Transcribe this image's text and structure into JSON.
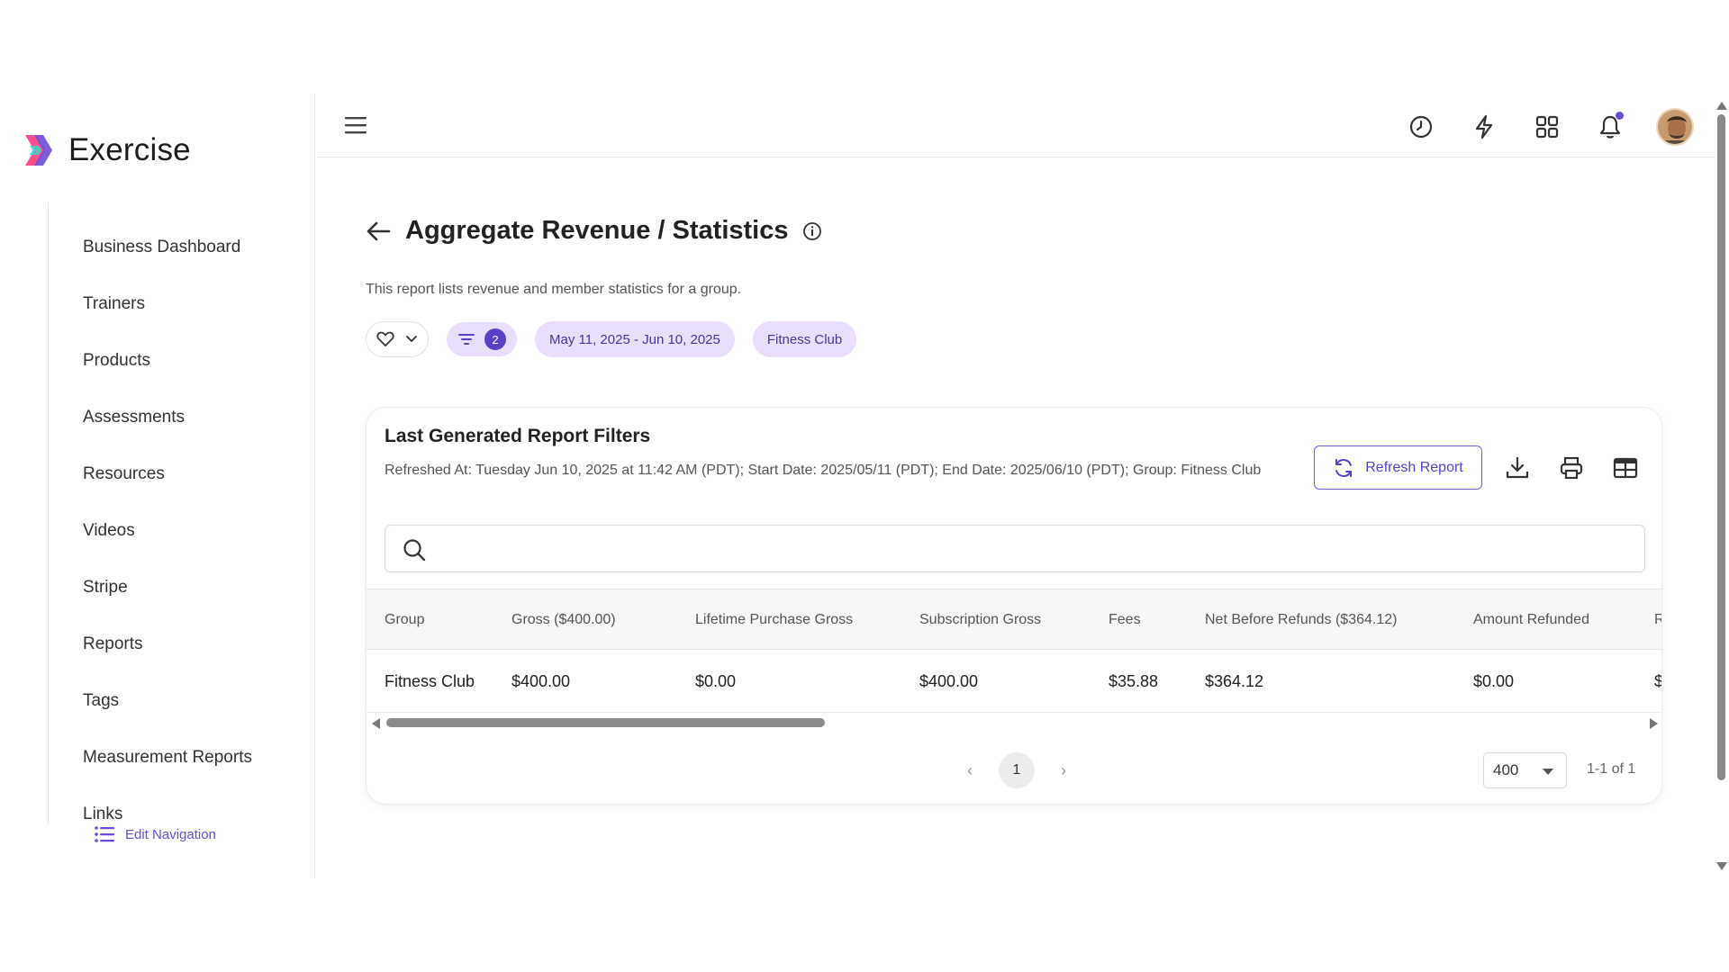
{
  "brand": {
    "name": "Exercise"
  },
  "sidebar": {
    "items": [
      {
        "label": "Business Dashboard"
      },
      {
        "label": "Trainers"
      },
      {
        "label": "Products"
      },
      {
        "label": "Assessments"
      },
      {
        "label": "Resources"
      },
      {
        "label": "Videos"
      },
      {
        "label": "Stripe"
      },
      {
        "label": "Reports"
      },
      {
        "label": "Tags"
      },
      {
        "label": "Measurement Reports"
      },
      {
        "label": "Links"
      }
    ],
    "edit_navigation": "Edit Navigation"
  },
  "topbar": {
    "icons": [
      "menu-icon",
      "history-icon",
      "lightning-icon",
      "grid-icon",
      "bell-icon",
      "avatar"
    ],
    "notification_dot_color": "#6a4bd8"
  },
  "page": {
    "title": "Aggregate Revenue / Statistics",
    "subtitle": "This report lists revenue and member statistics for a group.",
    "filters": {
      "filter_count": "2",
      "date_range": "May 11, 2025 - Jun 10, 2025",
      "group": "Fitness Club"
    }
  },
  "card": {
    "title": "Last Generated Report Filters",
    "description": "Refreshed At: Tuesday Jun 10, 2025 at 11:42 AM (PDT); Start Date: 2025/05/11 (PDT); End Date: 2025/06/10 (PDT); Group: Fitness Club",
    "refresh_label": "Refresh Report",
    "search_placeholder": ""
  },
  "table": {
    "columns": [
      "Group",
      "Gross ($400.00)",
      "Lifetime Purchase Gross",
      "Subscription Gross",
      "Fees",
      "Net Before Refunds ($364.12)",
      "Amount Refunded",
      "R"
    ],
    "rows": [
      [
        "Fitness Club",
        "$400.00",
        "$0.00",
        "$400.00",
        "$35.88",
        "$364.12",
        "$0.00",
        "$"
      ]
    ]
  },
  "pagination": {
    "current_page": "1",
    "per_page": "400",
    "range": "1-1 of 1"
  },
  "colors": {
    "accent": "#5b3fc9",
    "chip_bg": "#e9defb"
  }
}
